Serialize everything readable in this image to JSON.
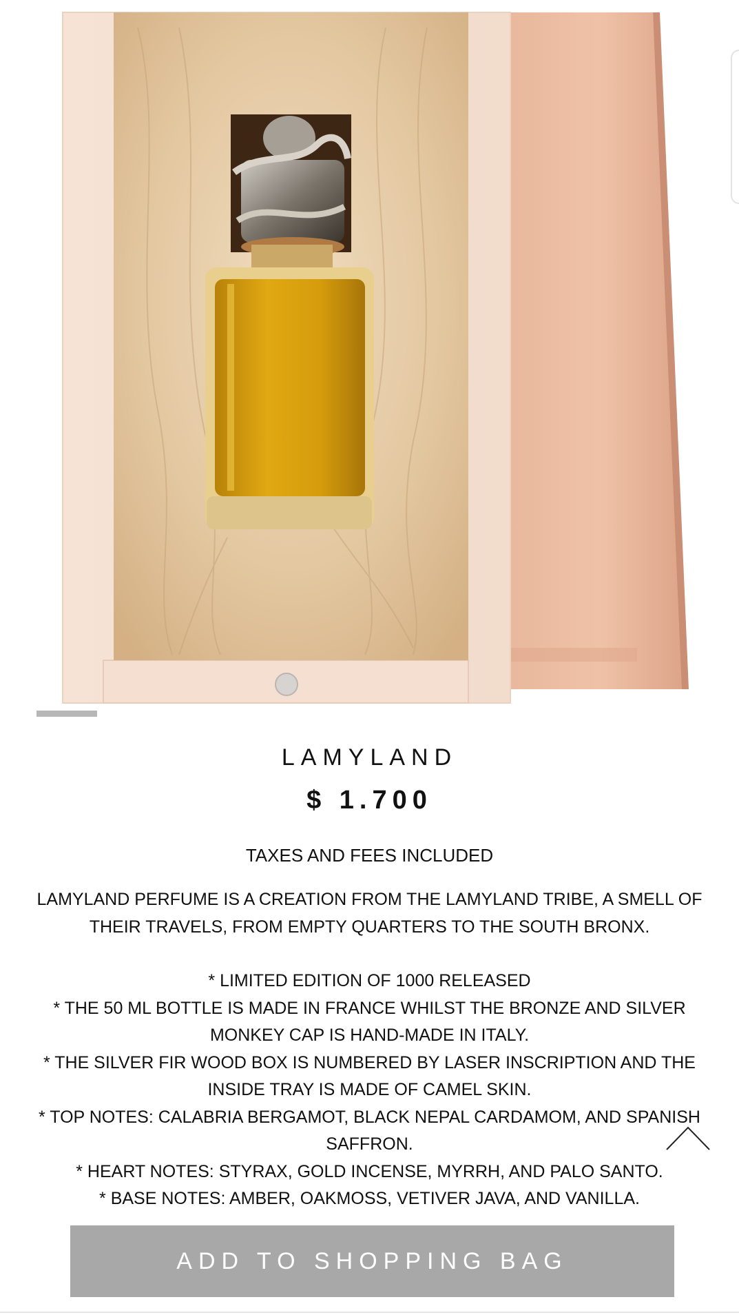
{
  "product": {
    "title": "LAMYLAND",
    "price": "$ 1.700",
    "taxes_note": "TAXES AND FEES INCLUDED"
  },
  "description": {
    "intro": "LAMYLAND PERFUME IS A CREATION FROM THE LAMYLAND TRIBE, A SMELL OF THEIR TRAVELS, FROM EMPTY QUARTERS TO THE SOUTH BRONX.",
    "bullets": [
      "* LIMITED EDITION OF 1000 RELEASED",
      "* THE 50 ML BOTTLE IS MADE IN FRANCE WHILST THE BRONZE AND SILVER MONKEY CAP IS HAND-MADE IN ITALY.",
      "* THE SILVER FIR WOOD BOX IS NUMBERED BY LASER INSCRIPTION AND THE INSIDE TRAY IS MADE OF CAMEL SKIN.",
      "* TOP NOTES: CALABRIA BERGAMOT, BLACK NEPAL CARDAMOM, AND SPANISH SAFFRON.",
      "* HEART NOTES: STYRAX, GOLD INCENSE, MYRRH, AND PALO SANTO.",
      "* BASE NOTES: AMBER, OAKMOSS, VETIVER JAVA, AND VANILLA."
    ]
  },
  "actions": {
    "add_to_bag": "ADD TO SHOPPING BAG"
  },
  "icons": {
    "back_to_top": "chevron-up-icon"
  },
  "colors": {
    "button_bg": "#a8a8a8",
    "text": "#111111",
    "perfume": "#d49d0c"
  }
}
